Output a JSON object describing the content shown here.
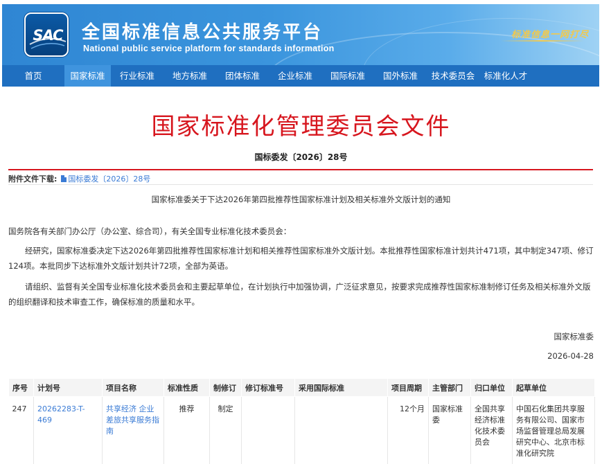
{
  "header": {
    "logo_text": "SAC",
    "title": "全国标准信息公共服务平台",
    "subtitle": "National public service platform  for standards information",
    "slogan": "标准信息一网打尽",
    "colors": {
      "banner": "#3b95dd",
      "nav": "#1f6fc0",
      "nav_active": "#3f94de",
      "slogan": "#f2c94c"
    }
  },
  "nav": {
    "items": [
      "首页",
      "国家标准",
      "行业标准",
      "地方标准",
      "团体标准",
      "企业标准",
      "国际标准",
      "国外标准",
      "技术委员会",
      "标准化人才"
    ],
    "active": "国家标准"
  },
  "document": {
    "title": "国家标准化管理委员会文件",
    "number": "国标委发〔2026〕28号",
    "title_color": "#d7161e",
    "attachment_label": "附件文件下载:",
    "attachment_name": "国标委发〔2026〕28号",
    "notice_title": "国家标准委关于下达2026年第四批推荐性国家标准计划及相关标准外文版计划的通知",
    "salutation": "国务院各有关部门办公厅（办公室、综合司），有关全国专业标准化技术委员会：",
    "paragraphs": [
      "经研究，国家标准委决定下达2026年第四批推荐性国家标准计划和相关推荐性国家标准外文版计划。本批推荐性国家标准计划共计471项，其中制定347项、修订124项。本批同步下达标准外文版计划共计72项，全部为英语。",
      "请组织、监督有关全国专业标准化技术委员会和主要起草单位，在计划执行中加强协调，广泛征求意见，按要求完成推荐性国家标准制修订任务及相关标准外文版的组织翻译和技术审查工作，确保标准的质量和水平。"
    ],
    "signature_org": "国家标准委",
    "signature_date": "2026-04-28"
  },
  "table": {
    "headers": [
      "序号",
      "计划号",
      "项目名称",
      "标准性质",
      "制修订",
      "修订标准号",
      "采用国际标准",
      "项目周期",
      "主管部门",
      "归口单位",
      "起草单位"
    ],
    "rows": [
      [
        "247",
        "20262283-T-469",
        "共享经济 企业差旅共享服务指南",
        "推荐",
        "制定",
        "",
        "",
        "12个月",
        "国家标准委",
        "全国共享经济标准化技术委员会",
        "中国石化集团共享服务有限公司、国家市场监督管理总局发展研究中心、北京市标准化研究院"
      ]
    ]
  }
}
